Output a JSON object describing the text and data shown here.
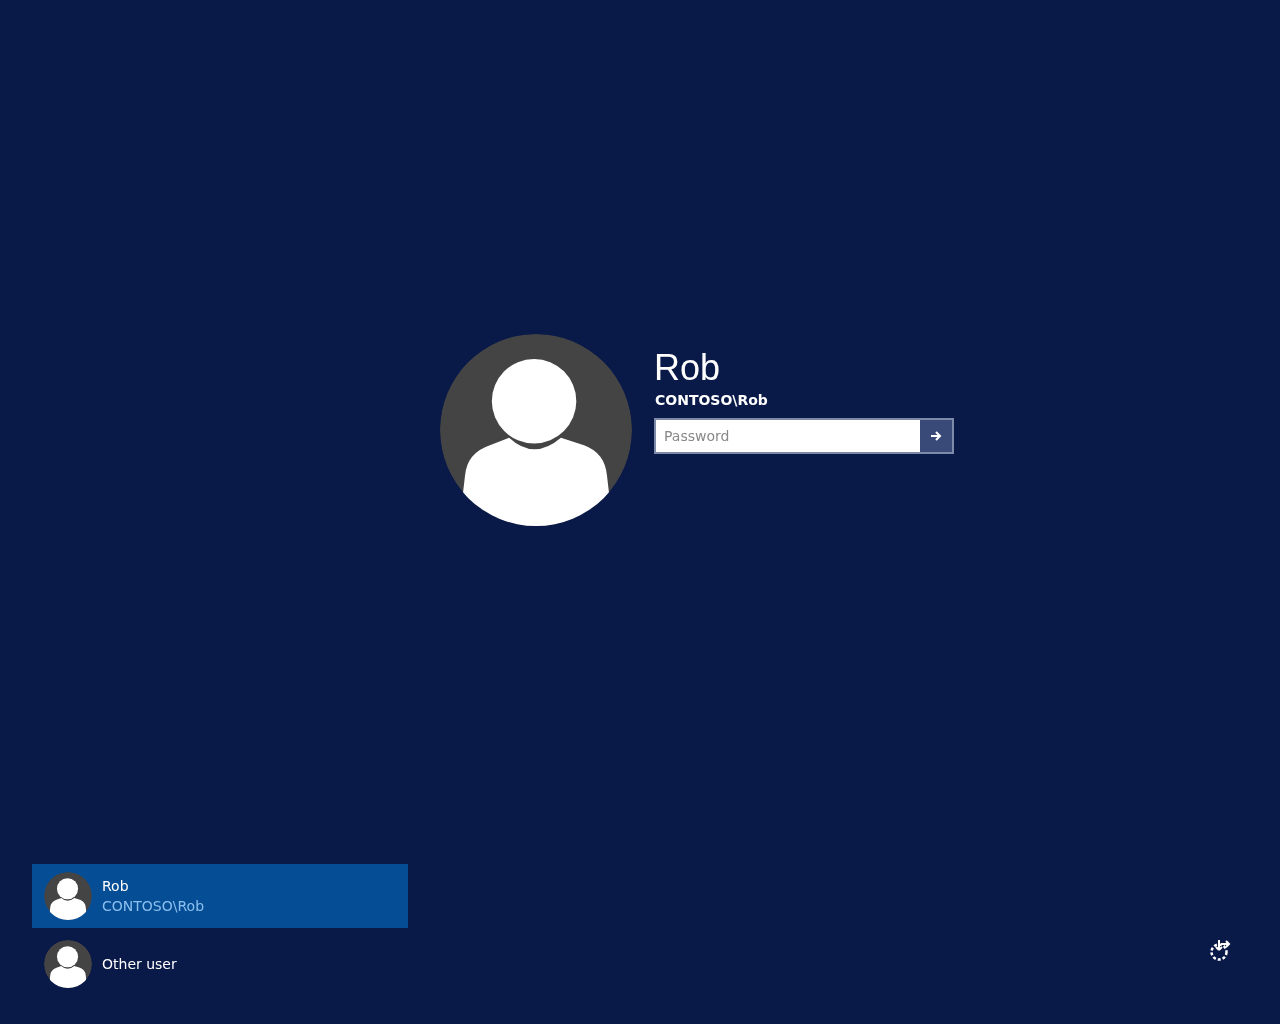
{
  "user": {
    "name": "Rob",
    "account": "CONTOSO\\Rob"
  },
  "password": {
    "placeholder": "Password"
  },
  "users": [
    {
      "name": "Rob",
      "account": "CONTOSO\\Rob",
      "selected": true
    },
    {
      "name": "Other user",
      "selected": false
    }
  ]
}
